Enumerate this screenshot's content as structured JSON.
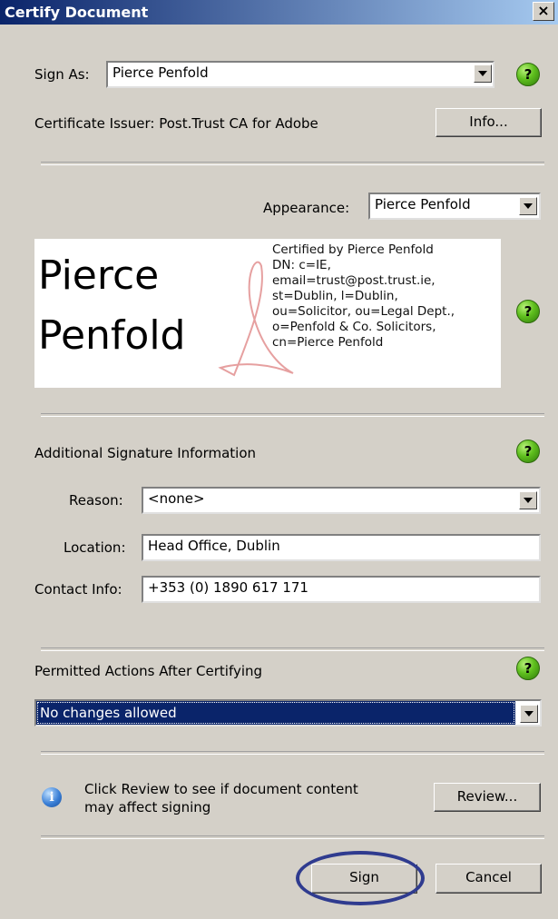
{
  "window": {
    "title": "Certify Document",
    "close_glyph": "×"
  },
  "sign_as": {
    "label": "Sign As:",
    "value": "Pierce Penfold"
  },
  "certificate": {
    "issuer_text": "Certificate Issuer: Post.Trust CA for Adobe",
    "info_button": "Info..."
  },
  "appearance": {
    "label": "Appearance:",
    "value": "Pierce Penfold"
  },
  "signature_preview": {
    "name_line1": "Pierce",
    "name_line2": "Penfold",
    "details": [
      "Certified by Pierce Penfold",
      "DN: c=IE,",
      "email=trust@post.trust.ie,",
      "st=Dublin, l=Dublin,",
      "ou=Solicitor, ou=Legal Dept.,",
      "o=Penfold & Co. Solicitors,",
      "cn=Pierce Penfold"
    ]
  },
  "additional_info": {
    "heading": "Additional Signature Information",
    "reason_label": "Reason:",
    "reason_value": "<none>",
    "location_label": "Location:",
    "location_value": "Head Office, Dublin",
    "contact_label": "Contact Info:",
    "contact_value": "+353 (0) 1890 617 171"
  },
  "permitted": {
    "heading": "Permitted Actions After Certifying",
    "value": "No changes allowed"
  },
  "review": {
    "text_line1": "Click Review to see if document content",
    "text_line2": "may affect signing",
    "button": "Review..."
  },
  "footer": {
    "sign_button": "Sign",
    "cancel_button": "Cancel"
  },
  "help_glyph": "?",
  "info_glyph": "i",
  "colors": {
    "title_bar": "#0a246a",
    "selection": "#0a246a",
    "dialog_bg": "#d4d0c8",
    "annotation_oval": "#2f3b8f"
  }
}
